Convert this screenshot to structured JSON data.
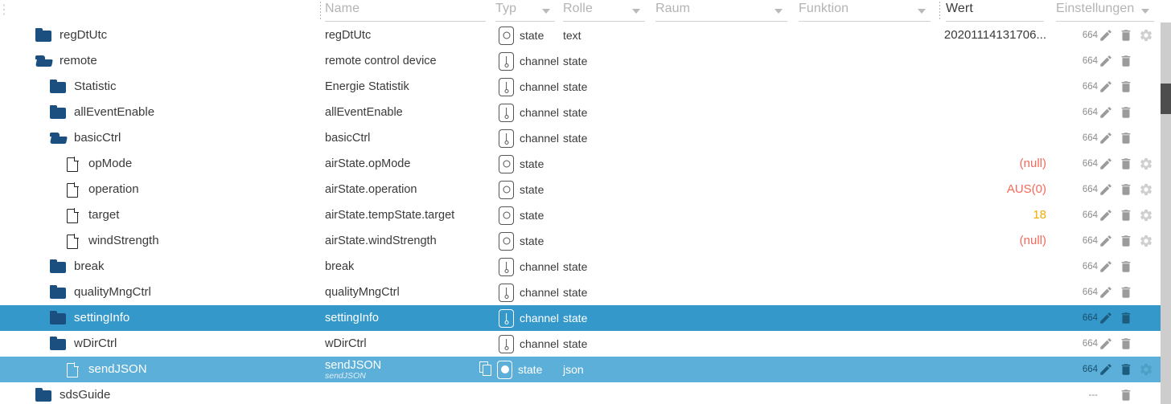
{
  "header": {
    "left_glyph": "⋮",
    "columns": [
      {
        "key": "tree",
        "label": "",
        "active": false,
        "caret": false
      },
      {
        "key": "name",
        "label": "Name",
        "active": false,
        "caret": false
      },
      {
        "key": "typ",
        "label": "Typ",
        "active": false,
        "caret": true
      },
      {
        "key": "rolle",
        "label": "Rolle",
        "active": false,
        "caret": true
      },
      {
        "key": "raum",
        "label": "Raum",
        "active": false,
        "caret": true
      },
      {
        "key": "funktion",
        "label": "Funktion",
        "active": false,
        "caret": true
      },
      {
        "key": "wert",
        "label": "Wert",
        "active": true,
        "caret": false
      },
      {
        "key": "einstellungen",
        "label": "Einstellungen",
        "active": false,
        "caret": true
      }
    ]
  },
  "icons": {
    "folder": "folder-icon",
    "folder_open": "folder-open-icon",
    "document": "document-icon",
    "copy": "copy-icon",
    "edit": "pencil-icon",
    "delete": "trash-icon",
    "settings": "gear-icon",
    "caret": "chevron-down-icon"
  },
  "colors": {
    "selected_primary": "#3498cb",
    "selected_secondary": "#5bafd8",
    "folder_blue": "#1b4f80",
    "value_red": "#f4695c",
    "value_orange": "#f0ab00",
    "header_placeholder": "#b3b3b3",
    "count_gray": "#8c8c8c",
    "scrollbar_track": "#cdcdcd",
    "scrollbar_thumb": "#4d4d4d"
  },
  "scrollbar": {
    "thumb_top_pct": 16,
    "thumb_height_pct": 8
  },
  "rows": [
    {
      "tree_label": "regDtUtc",
      "indent": 0,
      "icon": "folder",
      "name": "regDtUtc",
      "sub": "",
      "typ_icon": "state",
      "typ": "state",
      "rolle": "text",
      "wert": "20201114131706...",
      "wert_color": "#3a3a3a",
      "count": "664",
      "actions": [
        "edit",
        "delete",
        "settings"
      ],
      "selected": ""
    },
    {
      "tree_label": "remote",
      "indent": 0,
      "icon": "folder-open",
      "name": "remote control device",
      "sub": "",
      "typ_icon": "channel",
      "typ": "channel",
      "rolle": "state",
      "wert": "",
      "wert_color": "",
      "count": "664",
      "actions": [
        "edit",
        "delete"
      ],
      "selected": ""
    },
    {
      "tree_label": "Statistic",
      "indent": 1,
      "icon": "folder",
      "name": "Energie Statistik",
      "sub": "",
      "typ_icon": "channel",
      "typ": "channel",
      "rolle": "state",
      "wert": "",
      "wert_color": "",
      "count": "664",
      "actions": [
        "edit",
        "delete"
      ],
      "selected": ""
    },
    {
      "tree_label": "allEventEnable",
      "indent": 1,
      "icon": "folder",
      "name": "allEventEnable",
      "sub": "",
      "typ_icon": "channel",
      "typ": "channel",
      "rolle": "state",
      "wert": "",
      "wert_color": "",
      "count": "664",
      "actions": [
        "edit",
        "delete"
      ],
      "selected": ""
    },
    {
      "tree_label": "basicCtrl",
      "indent": 1,
      "icon": "folder-open",
      "name": "basicCtrl",
      "sub": "",
      "typ_icon": "channel",
      "typ": "channel",
      "rolle": "state",
      "wert": "",
      "wert_color": "",
      "count": "664",
      "actions": [
        "edit",
        "delete"
      ],
      "selected": ""
    },
    {
      "tree_label": "opMode",
      "indent": 2,
      "icon": "document",
      "name": "airState.opMode",
      "sub": "",
      "typ_icon": "state",
      "typ": "state",
      "rolle": "",
      "wert": "(null)",
      "wert_color": "#f4695c",
      "count": "664",
      "actions": [
        "edit",
        "delete",
        "settings"
      ],
      "selected": ""
    },
    {
      "tree_label": "operation",
      "indent": 2,
      "icon": "document",
      "name": "airState.operation",
      "sub": "",
      "typ_icon": "state",
      "typ": "state",
      "rolle": "",
      "wert": "AUS(0)",
      "wert_color": "#f4695c",
      "count": "664",
      "actions": [
        "edit",
        "delete",
        "settings"
      ],
      "selected": ""
    },
    {
      "tree_label": "target",
      "indent": 2,
      "icon": "document",
      "name": "airState.tempState.target",
      "sub": "",
      "typ_icon": "state",
      "typ": "state",
      "rolle": "",
      "wert": "18",
      "wert_color": "#f0ab00",
      "count": "664",
      "actions": [
        "edit",
        "delete",
        "settings"
      ],
      "selected": ""
    },
    {
      "tree_label": "windStrength",
      "indent": 2,
      "icon": "document",
      "name": "airState.windStrength",
      "sub": "",
      "typ_icon": "state",
      "typ": "state",
      "rolle": "",
      "wert": "(null)",
      "wert_color": "#f4695c",
      "count": "664",
      "actions": [
        "edit",
        "delete",
        "settings"
      ],
      "selected": ""
    },
    {
      "tree_label": "break",
      "indent": 1,
      "icon": "folder",
      "name": "break",
      "sub": "",
      "typ_icon": "channel",
      "typ": "channel",
      "rolle": "state",
      "wert": "",
      "wert_color": "",
      "count": "664",
      "actions": [
        "edit",
        "delete"
      ],
      "selected": ""
    },
    {
      "tree_label": "qualityMngCtrl",
      "indent": 1,
      "icon": "folder",
      "name": "qualityMngCtrl",
      "sub": "",
      "typ_icon": "channel",
      "typ": "channel",
      "rolle": "state",
      "wert": "",
      "wert_color": "",
      "count": "664",
      "actions": [
        "edit",
        "delete"
      ],
      "selected": ""
    },
    {
      "tree_label": "settingInfo",
      "indent": 1,
      "icon": "folder",
      "name": "settingInfo",
      "sub": "",
      "typ_icon": "channel",
      "typ": "channel",
      "rolle": "state",
      "wert": "",
      "wert_color": "",
      "count": "664",
      "actions": [
        "edit",
        "delete"
      ],
      "selected": "dark"
    },
    {
      "tree_label": "wDirCtrl",
      "indent": 1,
      "icon": "folder",
      "name": "wDirCtrl",
      "sub": "",
      "typ_icon": "channel",
      "typ": "channel",
      "rolle": "state",
      "wert": "",
      "wert_color": "",
      "count": "664",
      "actions": [
        "edit",
        "delete"
      ],
      "selected": ""
    },
    {
      "tree_label": "sendJSON",
      "indent": 2,
      "icon": "document",
      "name": "sendJSON",
      "sub": "sendJSON",
      "typ_icon": "state-filled",
      "typ": "state",
      "rolle": "json",
      "wert": "",
      "wert_color": "",
      "count": "664",
      "actions": [
        "edit",
        "delete",
        "settings"
      ],
      "selected": "light",
      "has_copy": true
    },
    {
      "tree_label": "sdsGuide",
      "indent": 0,
      "icon": "folder",
      "name": "",
      "sub": "",
      "typ_icon": "",
      "typ": "",
      "rolle": "",
      "wert": "",
      "wert_color": "",
      "count": "---",
      "actions": [
        "delete"
      ],
      "selected": ""
    }
  ]
}
